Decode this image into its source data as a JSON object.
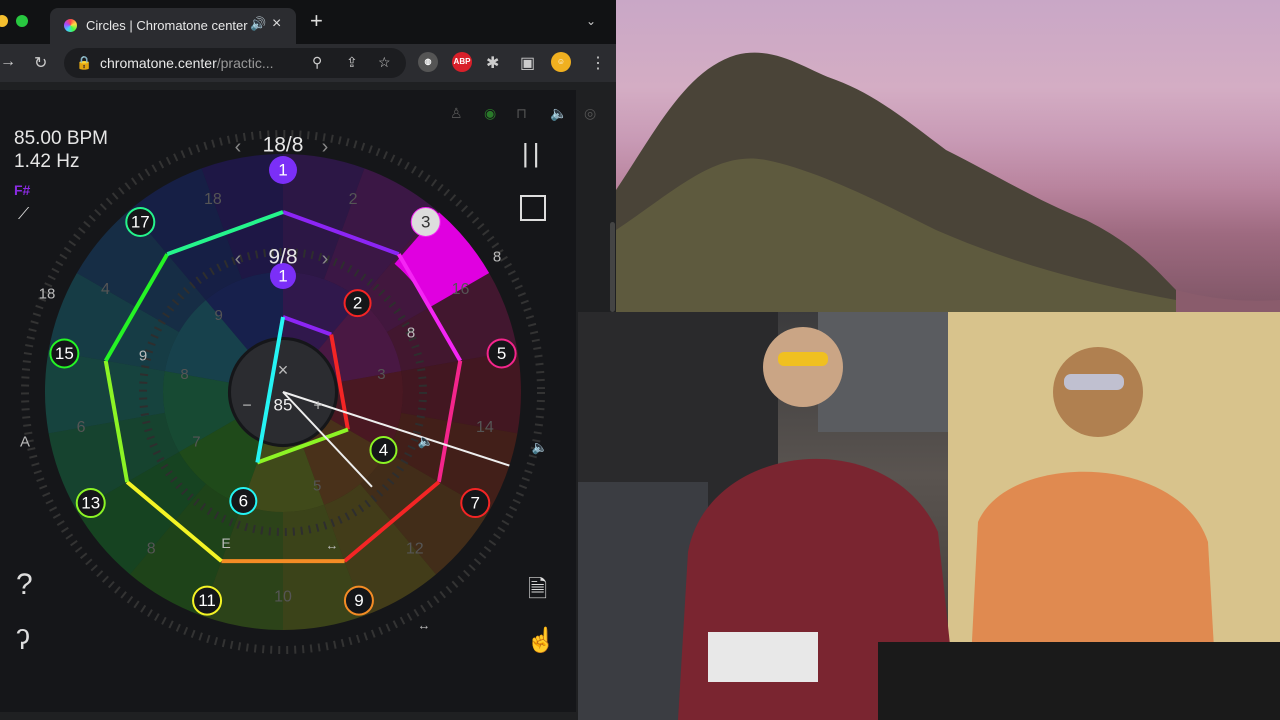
{
  "browser": {
    "tab_title": "Circles | Chromatone center",
    "url_domain": "chromatone.center",
    "url_path": "/practic...",
    "extension_abp": "ABP"
  },
  "app": {
    "bpm": "85.00 BPM",
    "hz": "1.42 Hz",
    "note": "F#",
    "tempo": "85",
    "tempo_minus": "−",
    "tempo_plus": "+",
    "tempo_close": "×",
    "outer_meter": {
      "label": "18/8",
      "steps": 18,
      "active_step": 3
    },
    "inner_meter": {
      "label": "9/8",
      "steps": 9,
      "active_step": 2
    },
    "outer_accents": [
      "1",
      "3",
      "5",
      "7",
      "9",
      "11",
      "13",
      "15",
      "17"
    ],
    "outer_faint": [
      "18",
      "2",
      "16",
      "14",
      "12",
      "10",
      "8",
      "6",
      "4"
    ],
    "outer_ring_marks": [
      "8",
      "18",
      "A",
      "E"
    ],
    "inner_accents": [
      "1",
      "2",
      "4",
      "6"
    ],
    "inner_faint": [
      "9",
      "8",
      "7",
      "5",
      "3"
    ],
    "inner_ring_marks": [
      "8",
      "9"
    ],
    "controls": {
      "pause": "||",
      "help": "?",
      "listen": "ear-icon"
    },
    "colors": {
      "accent_magenta": "#e000e0",
      "purple": "#7b2ff7",
      "blue": "#3f6bff",
      "cyan": "#20d0f0",
      "green": "#40e060",
      "yellow": "#e0e020",
      "orange": "#ff7a20",
      "red": "#ff2050"
    }
  }
}
